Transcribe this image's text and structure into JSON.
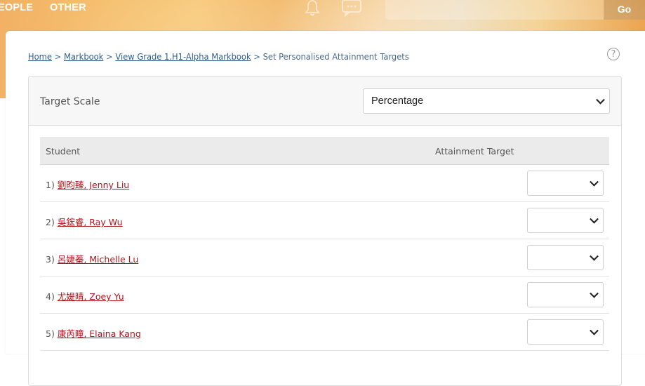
{
  "nav": {
    "people": "EOPLE",
    "other": "OTHER",
    "go": "Go"
  },
  "breadcrumb": [
    {
      "label": "Home",
      "link": true
    },
    {
      "label": "Markbook",
      "link": true
    },
    {
      "label": "View Grade 1.H1-Alpha Markbook",
      "link": true
    },
    {
      "label": "Set Personalised Attainment Targets",
      "link": false
    }
  ],
  "help": "?",
  "target_scale": {
    "label": "Target Scale",
    "selected": "Percentage"
  },
  "table": {
    "headers": {
      "student": "Student",
      "target": "Attainment Target"
    },
    "rows": [
      {
        "index": "1)",
        "name": "劉昀臻, Jenny Liu",
        "target": ""
      },
      {
        "index": "2)",
        "name": "吳鋐睿, Ray Wu",
        "target": ""
      },
      {
        "index": "3)",
        "name": "呂婕蓁, Michelle Lu",
        "target": ""
      },
      {
        "index": "4)",
        "name": "尤媞晴, Zoey Yu",
        "target": ""
      },
      {
        "index": "5)",
        "name": "康芮瞳, Elaina Kang",
        "target": ""
      }
    ]
  },
  "icons": [
    "bell-icon",
    "chat-icon",
    "help-icon",
    "chevron-down-icon"
  ],
  "colors": {
    "link": "#2f5d8c",
    "student_link": "#b0141c",
    "header_bg": "#ebebeb"
  }
}
